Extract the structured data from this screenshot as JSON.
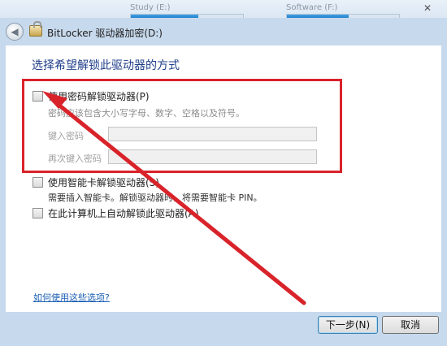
{
  "background": {
    "drive1": "Study (E:)",
    "drive2": "Software (F:)"
  },
  "dialog": {
    "title": "BitLocker 驱动器加密(D:)",
    "heading": "选择希望解锁此驱动器的方式"
  },
  "options": {
    "password": {
      "label": "使用密码解锁驱动器(P)",
      "hint": "密码应该包含大小写字母、数字、空格以及符号。",
      "enter_label": "键入密码",
      "reenter_label": "再次键入密码"
    },
    "smartcard": {
      "label": "使用智能卡解锁驱动器(S)",
      "hint": "需要插入智能卡。解锁驱动器时，将需要智能卡 PIN。"
    },
    "auto": {
      "label": "在此计算机上自动解锁此驱动器(A)"
    }
  },
  "links": {
    "help": "如何使用这些选项?"
  },
  "buttons": {
    "next": "下一步(N)",
    "cancel": "取消"
  },
  "annotation": {
    "color": "#d9232a"
  }
}
